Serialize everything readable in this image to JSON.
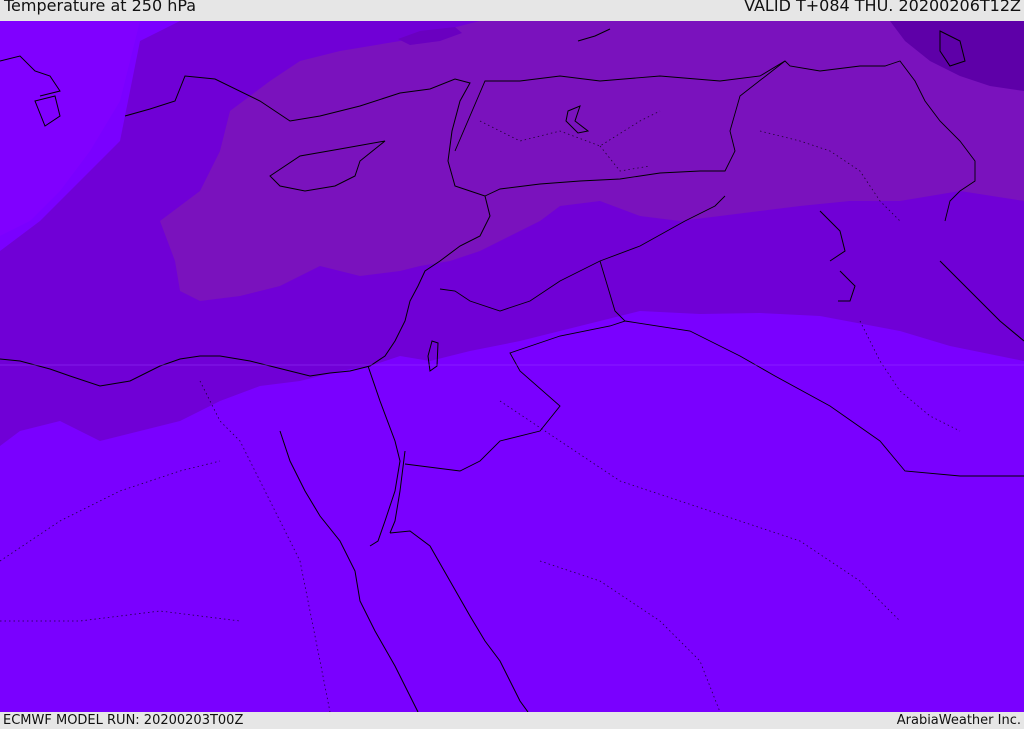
{
  "header": {
    "title": "Temperature at 250 hPa",
    "valid_time": "VALID T+084 THU. 20200206T12Z"
  },
  "footer": {
    "model_run": "ECMWF MODEL RUN: 20200203T00Z",
    "credit": "ArabiaWeather Inc."
  },
  "colors": {
    "coldest": "#5e00a8",
    "cold": "#7a12bd",
    "cool": "#7000d6",
    "mild": "#7a00ff",
    "brightest": "#8000ff",
    "coastline": "#000000"
  }
}
